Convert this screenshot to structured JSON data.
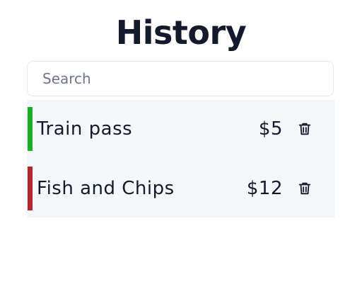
{
  "page": {
    "title": "History"
  },
  "search": {
    "placeholder": "Search",
    "value": ""
  },
  "items": [
    {
      "name": "Train pass",
      "amount": "$5",
      "indicator_color": "#1aae29",
      "delete_icon": "trash-icon"
    },
    {
      "name": "Fish and Chips",
      "amount": "$12",
      "indicator_color": "#b5262a",
      "delete_icon": "trash-icon"
    }
  ],
  "colors": {
    "text": "#131a2c",
    "list_background": "#f5f8fb",
    "search_border": "#e4e8ef",
    "placeholder": "#6b7689"
  }
}
